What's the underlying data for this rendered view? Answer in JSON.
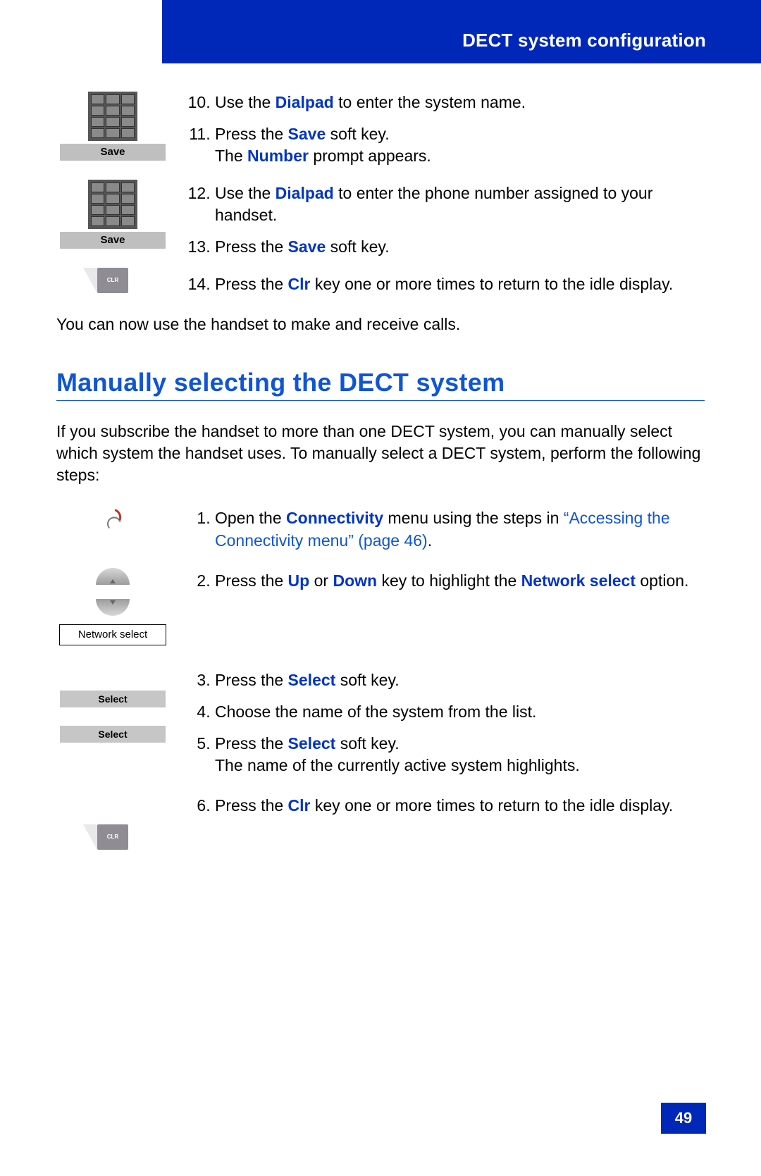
{
  "header": {
    "running_title": "DECT system configuration"
  },
  "icons": {
    "save1": "Save",
    "save2": "Save",
    "network_select_label": "Network select",
    "select1": "Select",
    "select2": "Select",
    "clr": "CLR"
  },
  "steps_top": [
    {
      "n": 10,
      "pre": "Use the ",
      "key": "Dialpad",
      "post": " to enter the system name."
    },
    {
      "n": 11,
      "pre": "Press the ",
      "key": "Save",
      "post": " soft key.",
      "sub_pre": "The ",
      "sub_key": "Number",
      "sub_post": " prompt appears."
    },
    {
      "n": 12,
      "pre": "Use the ",
      "key": "Dialpad",
      "post": " to enter the phone number assigned to your handset."
    },
    {
      "n": 13,
      "pre": "Press the ",
      "key": "Save",
      "post": " soft key."
    },
    {
      "n": 14,
      "pre": "Press the ",
      "key": "Clr",
      "post": " key one or more times to return to the idle display."
    }
  ],
  "body_line": "You can now use the handset to make and receive calls.",
  "section_title": "Manually selecting the DECT system",
  "intro": "If you subscribe the handset to more than one DECT system, you can manually select which system the handset uses. To manually select a DECT system, perform the following steps:",
  "steps_bottom": [
    {
      "n": 1,
      "pre": "Open the ",
      "key": "Connectivity",
      "post": " menu using the steps in ",
      "link": "“Accessing the Connectivity menu” (page 46)",
      "post2": "."
    },
    {
      "n": 2,
      "pre": "Press the ",
      "key1": "Up",
      "mid": " or ",
      "key2": "Down",
      "post1": " key to highlight the ",
      "key3": "Network select",
      "post2": " option."
    },
    {
      "n": 3,
      "pre": "Press the ",
      "key": "Select",
      "post": " soft key."
    },
    {
      "n": 4,
      "text": "Choose the name of the system from the list."
    },
    {
      "n": 5,
      "pre": "Press the ",
      "key": "Select",
      "post": " soft key.",
      "sub": "The name of the currently active system highlights."
    },
    {
      "n": 6,
      "pre": "Press the ",
      "key": "Clr",
      "post": " key one or more times to return to the idle display."
    }
  ],
  "page_number": "49"
}
